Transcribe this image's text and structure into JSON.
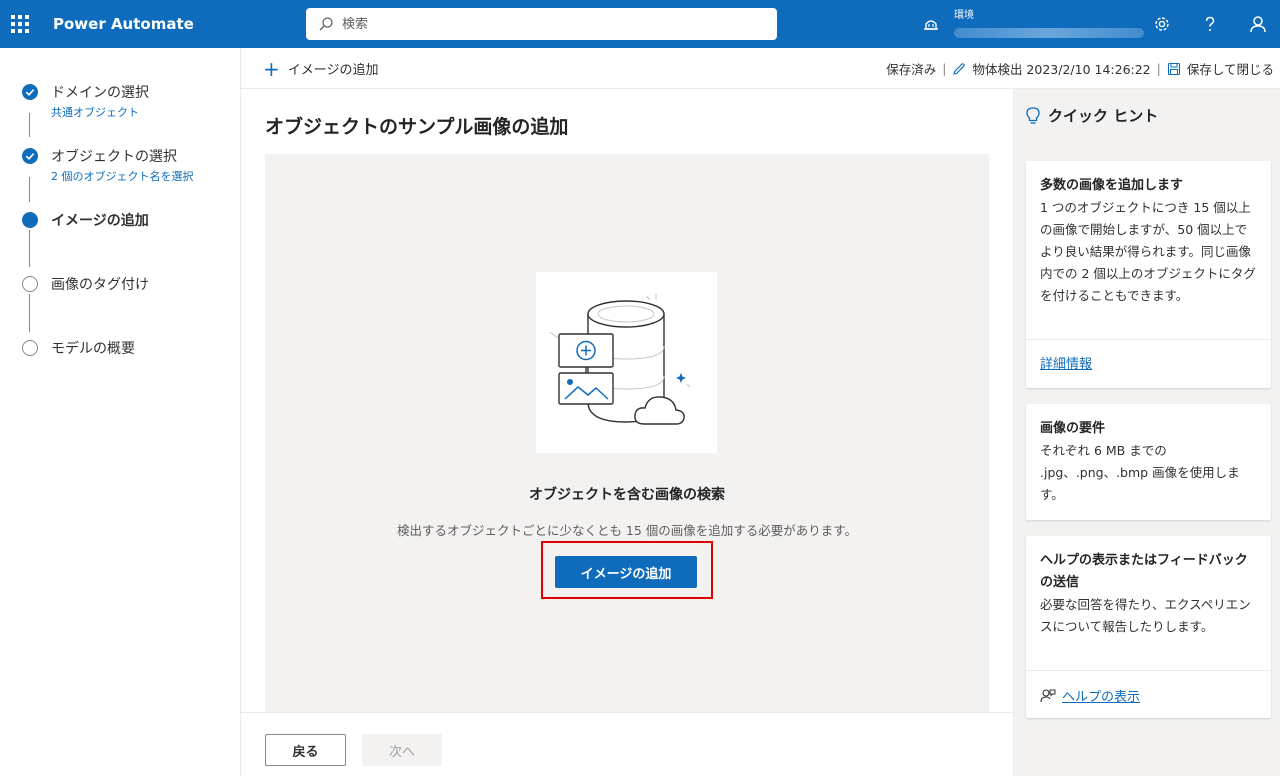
{
  "topbar": {
    "app_title": "Power Automate",
    "search_placeholder": "検索",
    "env_label": "環境",
    "icons": [
      "waffle-icon",
      "search-icon",
      "environment-icon",
      "settings-icon",
      "help-icon",
      "account-icon"
    ]
  },
  "steps": [
    {
      "title": "ドメインの選択",
      "sub": "共通オブジェクト",
      "state": "done"
    },
    {
      "title": "オブジェクトの選択",
      "sub": "2 個のオブジェクト名を選択",
      "state": "done"
    },
    {
      "title": "イメージの追加",
      "sub": "",
      "state": "current"
    },
    {
      "title": "画像のタグ付け",
      "sub": "",
      "state": "pending"
    },
    {
      "title": "モデルの概要",
      "sub": "",
      "state": "pending"
    }
  ],
  "cmdbar": {
    "add_image": "イメージの追加",
    "saved": "保存済み",
    "sep": "|",
    "model_name": "物体検出 2023/2/10 14:26:22",
    "save_close": "保存して閉じる"
  },
  "main": {
    "title": "オブジェクトのサンプル画像の追加",
    "dz_heading": "オブジェクトを含む画像の検索",
    "dz_desc": "検出するオブジェクトごとに少なくとも 15 個の画像を追加する必要があります。",
    "add_button": "イメージの追加"
  },
  "footer": {
    "back": "戻る",
    "next": "次へ"
  },
  "hints": {
    "title": "クイック ヒント",
    "cards": [
      {
        "title": "多数の画像を追加します",
        "body": "1 つのオブジェクトにつき 15 個以上の画像で開始しますが、50 個以上でより良い結果が得られます。同じ画像内での 2 個以上のオブジェクトにタグを付けることもできます。",
        "link": "詳細情報"
      },
      {
        "title": "画像の要件",
        "body": "それぞれ 6 MB までの .jpg、.png、.bmp 画像を使用します。",
        "link": ""
      },
      {
        "title": "ヘルプの表示またはフィードバックの送信",
        "body": "必要な回答を得たり、エクスペリエンスについて報告したりします。",
        "link": "ヘルプの表示"
      }
    ]
  },
  "colors": {
    "brand": "#0f6cbd",
    "highlight": "#e00000"
  }
}
